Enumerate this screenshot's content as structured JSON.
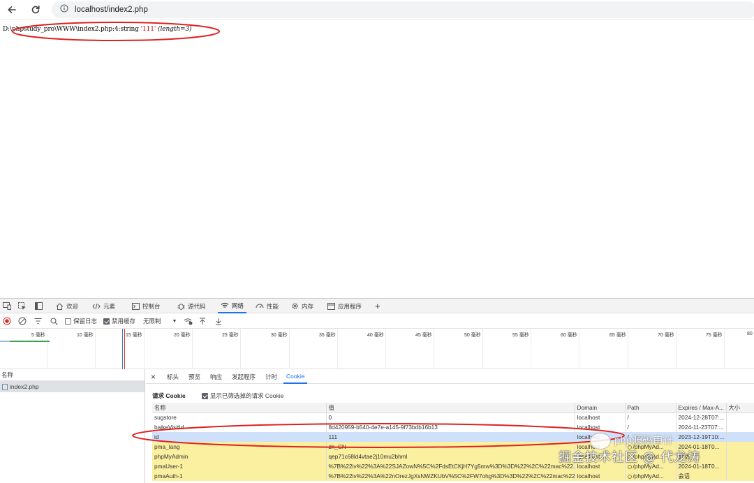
{
  "browser": {
    "url": "localhost/index2.php",
    "icons": [
      "back-icon",
      "reload-icon",
      "info-icon"
    ]
  },
  "page": {
    "dump_path": "D:\\phpstudy_pro\\WWW\\index2.php:4:",
    "dump_type": "string ",
    "dump_value": "'111'",
    "dump_length": "(length=3)"
  },
  "devtools": {
    "tabs": [
      {
        "label": "欢迎",
        "icon": "home-icon"
      },
      {
        "label": "元素",
        "icon": "code-icon"
      },
      {
        "label": "控制台",
        "icon": "console-icon"
      },
      {
        "label": "源代码",
        "icon": "bug-icon"
      },
      {
        "label": "网络",
        "icon": "wifi-icon"
      },
      {
        "label": "性能",
        "icon": "performance-icon"
      },
      {
        "label": "内存",
        "icon": "gear-icon"
      },
      {
        "label": "应用程序",
        "icon": "application-icon"
      }
    ],
    "active_tab": "网络",
    "network_toolbar": {
      "preserve_log": "保留日志",
      "disable_cache": "禁用缓存",
      "throttle": "无限制"
    },
    "timeline_ticks": [
      "5 毫秒",
      "10 毫秒",
      "15 毫秒",
      "20 毫秒",
      "25 毫秒",
      "30 毫秒",
      "35 毫秒",
      "40 毫秒",
      "45 毫秒",
      "50 毫秒",
      "55 毫秒",
      "60 毫秒",
      "65 毫秒",
      "70 毫秒",
      "75 毫秒",
      "80"
    ],
    "request_list": {
      "header": "名称",
      "items": [
        "index2.php"
      ]
    },
    "detail_tabs": [
      "标头",
      "预览",
      "响应",
      "发起程序",
      "计时",
      "Cookie"
    ],
    "active_detail_tab": "Cookie",
    "cookies": {
      "section_title": "请求 Cookie",
      "filter_label": "显示已筛选掉的请求 Cookie",
      "columns": [
        "名称",
        "值",
        "Domain",
        "Path",
        "Expires / Max-A...",
        "大小"
      ],
      "rows": [
        [
          "sugstore",
          "0",
          "localhost",
          "/",
          "2024-12-28T07:...",
          ""
        ],
        [
          "baikeVisitId",
          "8d420959-b540-4e7e-a145-9f73bdb16b13",
          "localhost",
          "/",
          "2024-11-23T07:...",
          ""
        ],
        [
          "id",
          "111",
          "localhost",
          "/",
          "2023-12-19T10:...",
          ""
        ],
        [
          "pma_lang",
          "zh_CN",
          "localhost",
          "/phpMyAd...",
          "2024-01-18T0...",
          ""
        ],
        [
          "phpMyAdmin",
          "qep71c68ld4vtae2j10mu2bhml",
          "localhost",
          "/phpMyAd...",
          "会话",
          ""
        ],
        [
          "pmaUser-1",
          "%7B%22iv%22%3A%22SJAZowN%5C%2FdsEtCKjH7Yg5mw%3D%3D%22%2C%22mac%22...",
          "localhost",
          "/phpMyAd...",
          "2024-01-18T0...",
          ""
        ],
        [
          "pmaAuth-1",
          "%7B%22iv%22%3A%22nOrezJgXsNWZKUbV%5C%2FW7ohg%3D%3D%22%2C%22mac%22...",
          "localhost",
          "/phpMyAd...",
          "会话",
          ""
        ]
      ]
    }
  },
  "watermark": {
    "top": "php源码审计",
    "bottom": "掘金技术社区 @ 代龙涛"
  },
  "colors": {
    "annotation_circle": "#e02020",
    "active_tab": "#1a73e8",
    "selected_row": "#cfe0fa",
    "warning_row": "#fbf0a0"
  }
}
